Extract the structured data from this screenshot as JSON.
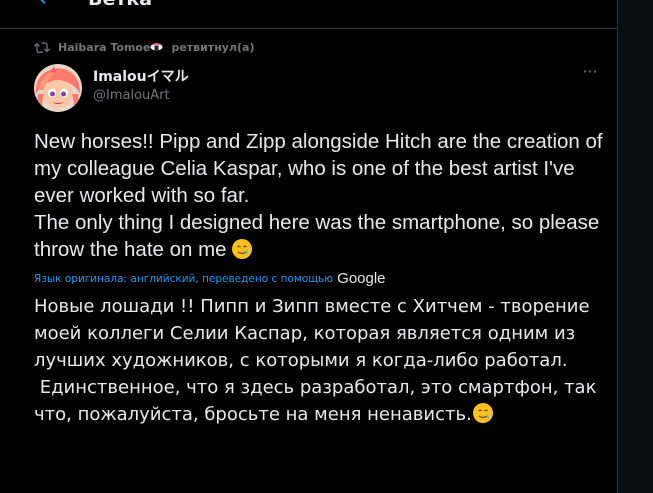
{
  "header": {
    "back_icon": "arrow-left-icon",
    "title": "Ветка"
  },
  "retweet": {
    "icon": "retweet-icon",
    "user": "Haibara Tomoe",
    "suffix": "ретвитнул(а)"
  },
  "author": {
    "name": "Imalouイマル",
    "handle": "@ImalouArt"
  },
  "more_label": "···",
  "tweet": {
    "lines": [
      "New horses!! Pipp and Zipp alongside Hitch are the creation of my colleague Celia Kaspar, who is one of the best artist I've ever worked with so far.",
      "The only thing I designed here was the smartphone, so please throw the hate on me"
    ]
  },
  "translation_note": {
    "text": "Язык оригинала: английский, переведено с помощью",
    "provider": "Google"
  },
  "translation": {
    "lines": [
      "Новые лошади !! Пипп и Зипп вместе с Хитчем - творение моей коллеги Селии Каспар, которая является одним из лучших художников, с которыми я когда-либо работал.",
      " Единственное, что я здесь разработал, это смартфон, так что, пожалуйста, бросьте на меня ненависть."
    ]
  },
  "colors": {
    "background": "#000000",
    "text": "#e7e9ea",
    "secondary": "#71767b",
    "accent": "#1d9bf0",
    "border": "#2f3336"
  }
}
